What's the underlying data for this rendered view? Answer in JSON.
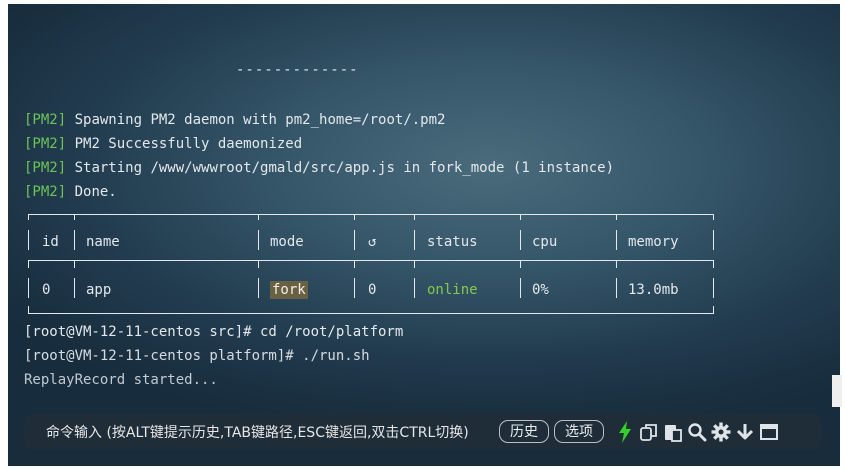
{
  "terminal": {
    "separator": "-------------",
    "pm2_tag": "[PM2]",
    "pm2_lines": [
      "Spawning PM2 daemon with pm2_home=/root/.pm2",
      "PM2 Successfully daemonized",
      "Starting /www/wwwroot/gmald/src/app.js in fork_mode (1 instance)",
      "Done."
    ],
    "table": {
      "headers": [
        "id",
        "name",
        "mode",
        "↺",
        "status",
        "cpu",
        "memory"
      ],
      "row": [
        "0",
        "app",
        "fork",
        "0",
        "online",
        "0%",
        "13.0mb"
      ]
    },
    "shell_lines": [
      "[root@VM-12-11-centos src]# cd /root/platform",
      "[root@VM-12-11-centos platform]# ./run.sh",
      "ReplayRecord started..."
    ]
  },
  "cmdbar": {
    "placeholder": "命令输入 (按ALT键提示历史,TAB键路径,ESC键返回,双击CTRL切换)",
    "history_label": "历史",
    "options_label": "选项",
    "icons": [
      "bolt-icon",
      "copy-icon",
      "paste-icon",
      "search-icon",
      "gear-icon",
      "download-icon",
      "window-icon"
    ]
  },
  "colors": {
    "pm2_tag": "#6dc35a",
    "online": "#84c94c",
    "bolt": "#33d12a",
    "terminal_text": "#e3e8ec"
  }
}
